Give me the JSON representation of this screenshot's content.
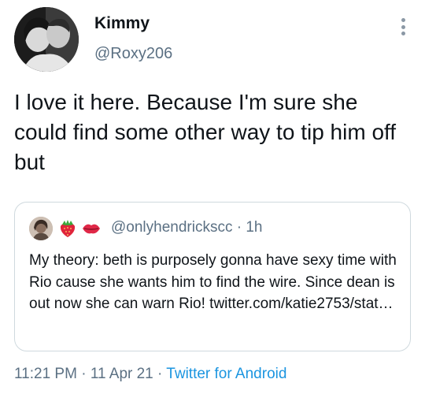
{
  "author": {
    "display_name": "Kimmy",
    "handle": "@Roxy206",
    "avatar_icon": "profile-photo"
  },
  "menu": {
    "icon": "more-vertical-icon"
  },
  "tweet": {
    "text": "I love it here. Because I'm sure she could find some other way to tip him off but"
  },
  "quoted_tweet": {
    "emojis": [
      "strawberry",
      "kiss-lips"
    ],
    "handle": "@onlyhendrickscc",
    "separator": "·",
    "time": "1h",
    "text": "My theory: beth is purposely gonna have sexy time with Rio cause she wants him to find the wire. Since dean is out now she can warn Rio! twitter.com/katie2753/stat…"
  },
  "meta": {
    "time": "11:21 PM",
    "separator": "·",
    "date": "11 Apr 21",
    "source": "Twitter for Android"
  },
  "colors": {
    "text": "#0f1419",
    "secondary": "#5b7083",
    "link": "#1b95e0",
    "border": "#cfd9de"
  }
}
